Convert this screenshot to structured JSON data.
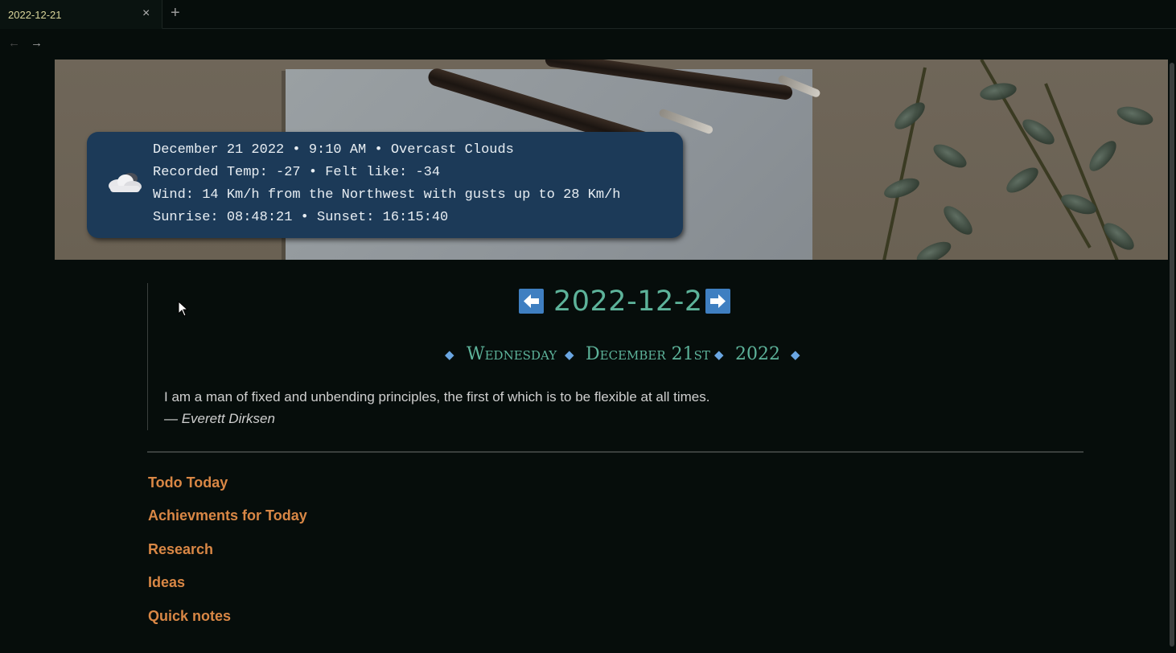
{
  "tab": {
    "title": "2022-12-21",
    "close_glyph": "×",
    "new_tab_glyph": "+"
  },
  "nav": {
    "back_glyph": "←",
    "forward_glyph": "→"
  },
  "weather": {
    "icon": "cloud-icon",
    "line1": "December 21 2022 • 9:10 AM • Overcast Clouds",
    "line2": "Recorded Temp: -27 • Felt like: -34",
    "line3": "Wind: 14 Km/h from the Northwest with gusts up to 28 Km/h",
    "line4": "Sunrise: 08:48:21 • Sunset: 16:15:40"
  },
  "note": {
    "title": "2022-12-21",
    "prev_icon": "arrow-left-icon",
    "next_icon": "arrow-right-icon",
    "weekday": "Wednesday",
    "monthday": "December 21st",
    "year": "2022",
    "diamond": "◆",
    "quote": "I am a man of fixed and unbending principles, the first of which is to be flexible at all times.",
    "quote_author": "— Everett Dirksen",
    "sections": [
      "Todo Today",
      "Achievments for Today",
      "Research",
      "Ideas",
      "Quick notes"
    ]
  },
  "colors": {
    "background": "#060d0b",
    "accent_green": "#5db39a",
    "section_orange": "#d98745",
    "arrow_blue": "#3f7fc1",
    "weather_card": "#1c3a58"
  }
}
